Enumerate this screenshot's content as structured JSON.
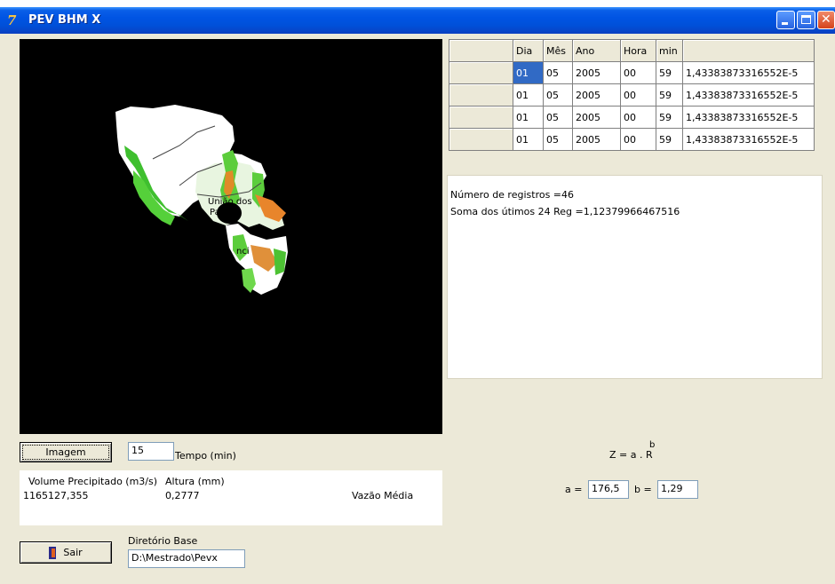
{
  "window": {
    "title": "PEV BHM X",
    "app_icon_glyph": "7"
  },
  "map": {
    "labels": [
      "União dos",
      "Palm",
      "nci"
    ]
  },
  "grid": {
    "headers": [
      "",
      "Dia",
      "Mês",
      "Ano",
      "Hora",
      "min",
      ""
    ],
    "rows": [
      [
        "",
        "01",
        "05",
        "2005",
        "00",
        "59",
        "1,43383873316552E-5"
      ],
      [
        "",
        "01",
        "05",
        "2005",
        "00",
        "59",
        "1,43383873316552E-5"
      ],
      [
        "",
        "01",
        "05",
        "2005",
        "00",
        "59",
        "1,43383873316552E-5"
      ],
      [
        "",
        "01",
        "05",
        "2005",
        "00",
        "59",
        "1,43383873316552E-5"
      ]
    ]
  },
  "memo": {
    "line1": "Número de registros =46",
    "line2": "Soma dos útimos 24 Reg =1,12379966467516"
  },
  "controls": {
    "imagem_button": "Imagem",
    "tempo_value": "15",
    "tempo_label": "Tempo (min)",
    "sair_button": "Sair",
    "diretorio_label": "Diretório Base",
    "diretorio_value": "D:\\Mestrado\\Pevx"
  },
  "results": {
    "volume_label": "Volume Precipitado (m3/s)",
    "volume_value": "1165127,355",
    "altura_label": "Altura (mm)",
    "altura_value": "0,2777",
    "vazao_label": "Vazão Média"
  },
  "formula": {
    "text": "Z = a . R",
    "exponent": "b",
    "a_label": "a =",
    "a_value": "176,5",
    "b_label": "b =",
    "b_value": "1,29"
  },
  "colors": {
    "titlebar": "#0054e3",
    "selection": "#316ac5",
    "window_bg": "#ece9d8"
  }
}
